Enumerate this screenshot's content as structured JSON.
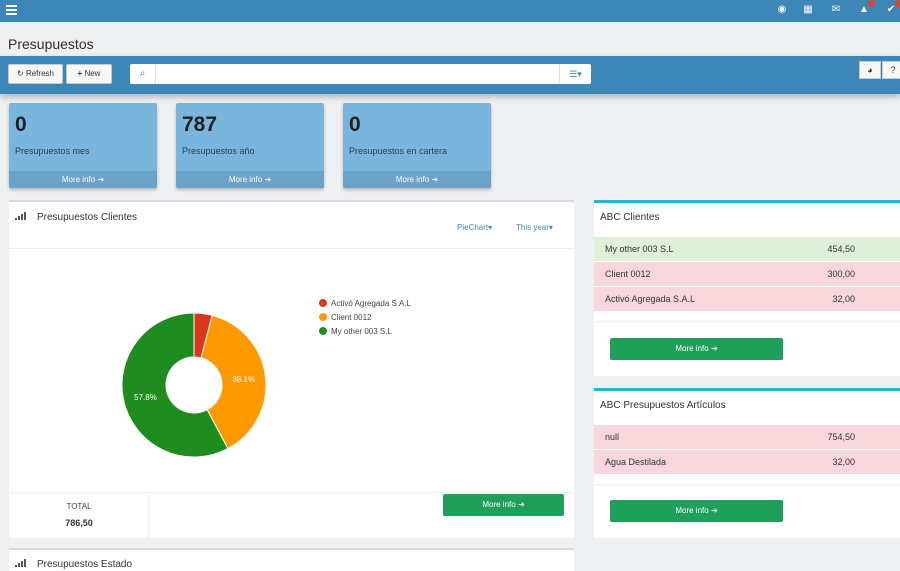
{
  "page": {
    "title": "Presupuestos"
  },
  "toolbar": {
    "refresh_label": "Refresh",
    "new_label": "New",
    "search": {
      "value": "",
      "placeholder": ""
    }
  },
  "stats": [
    {
      "value": "0",
      "label": "Presupuestos mes",
      "more": "More info"
    },
    {
      "value": "787",
      "label": "Presupuestos año",
      "more": "More info"
    },
    {
      "value": "0",
      "label": "Presupuestos en cartera",
      "more": "More info"
    }
  ],
  "clients_panel": {
    "title": "Presupuestos Clientes",
    "chart_type_label": "PieChart",
    "period_label": "This year",
    "total_label": "TOTAL",
    "total_value": "786,50",
    "more": "More info"
  },
  "chart_data": {
    "type": "pie",
    "title": "",
    "donut": true,
    "legend_position": "right",
    "slices": [
      {
        "label": "Activó Agregada S.A.L",
        "value": 32.0,
        "color": "#d9381e"
      },
      {
        "label": "Client 0012",
        "value": 300.0,
        "color": "#ff9900"
      },
      {
        "label": "My other 003 S.L",
        "value": 454.5,
        "color": "#1f8c1f"
      }
    ],
    "data_labels": [
      "",
      "38.1%",
      "57.8%"
    ]
  },
  "abc_clientes": {
    "title": "ABC Clientes",
    "rows": [
      {
        "name": "My other 003 S.L",
        "value": "454,50",
        "status": "green"
      },
      {
        "name": "Client 0012",
        "value": "300,00",
        "status": "red"
      },
      {
        "name": "Activó Agregada S.A.L",
        "value": "32,00",
        "status": "red"
      }
    ],
    "more": "More info"
  },
  "abc_articulos": {
    "title": "ABC Presupuestos Artículos",
    "rows": [
      {
        "name": "null",
        "value": "754,50",
        "status": "red"
      },
      {
        "name": "Agua Destilada",
        "value": "32,00",
        "status": "red"
      }
    ],
    "more": "More info"
  },
  "estado_panel": {
    "title": "Presupuestos Estado"
  },
  "colors": {
    "brand": "#3d86b8",
    "stat_box": "#7ab5de",
    "action_green": "#1fa05a",
    "row_green": "#dff0d8",
    "row_red": "#f8d7dc",
    "panel_accent": "#29b6d6"
  },
  "icons": {
    "menu": "hamburger-icon",
    "top": [
      "map-marker-icon",
      "calendar-icon",
      "envelope-icon",
      "bell-icon",
      "check-circle-icon"
    ]
  }
}
